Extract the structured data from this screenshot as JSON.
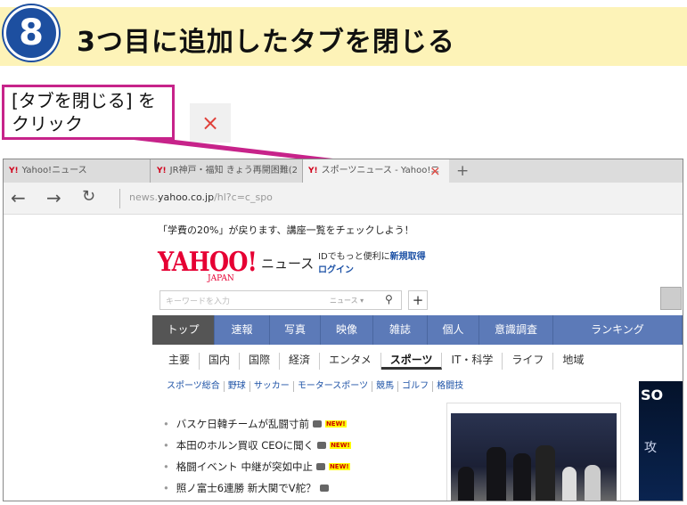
{
  "step": {
    "number": "8",
    "title": "3つ目に追加したタブを閉じる"
  },
  "callout": {
    "line1": "[タブを閉じる] を",
    "line2": "クリック"
  },
  "close_icon_glyph": "×",
  "browser": {
    "tabs": [
      {
        "logo": "Y!",
        "label": "Yahoo!ニュース"
      },
      {
        "logo": "Y!",
        "label": "JR神戸・福知 きょう再開困難(2"
      },
      {
        "logo": "Y!",
        "label": "スポーツニュース - Yahoo!ニ"
      }
    ],
    "tab_close": "×",
    "new_tab": "+",
    "address_prefix": "news.",
    "address_domain": "yahoo.co.jp",
    "address_path": "/hl?c=c_spo"
  },
  "page": {
    "notice": "「学費の20%」が戻ります、講座一覧をチェックしよう！",
    "logo_text": "YAHOO!",
    "logo_sub": "JAPAN",
    "logo_news": "ニュース",
    "login_text": "IDでもっと便利に",
    "login_link": "新規取得",
    "login": "ログイン",
    "search_placeholder": "キーワードを入力",
    "search_category": "ニュース ▾",
    "add_button": "+",
    "main_nav": [
      "トップ",
      "速報",
      "写真",
      "映像",
      "雑誌",
      "個人",
      "意識調査",
      "ランキング"
    ],
    "sub_nav": [
      "主要",
      "国内",
      "国際",
      "経済",
      "エンタメ",
      "スポーツ",
      "IT・科学",
      "ライフ",
      "地域"
    ],
    "categories": [
      "スポーツ総合",
      "野球",
      "サッカー",
      "モータースポーツ",
      "競馬",
      "ゴルフ",
      "格闘技"
    ],
    "news": [
      {
        "title": "バスケ日韓チームが乱闘寸前",
        "new": "NEW!"
      },
      {
        "title": "本田のホルン買収 CEOに聞く",
        "new": "NEW!"
      },
      {
        "title": "格闘イベント 中継が突如中止",
        "new": "NEW!"
      },
      {
        "title": "照ノ富士6連勝 新大関でV舵？",
        "new": ""
      }
    ],
    "ad_text": "SO",
    "ad_sub": "攻"
  },
  "colors": {
    "accent": "#c7238a",
    "badge": "#1d4fa0",
    "header_bg": "#fdf3b8",
    "nav_bg": "#5c7ab8",
    "yahoo_red": "#e60033"
  }
}
